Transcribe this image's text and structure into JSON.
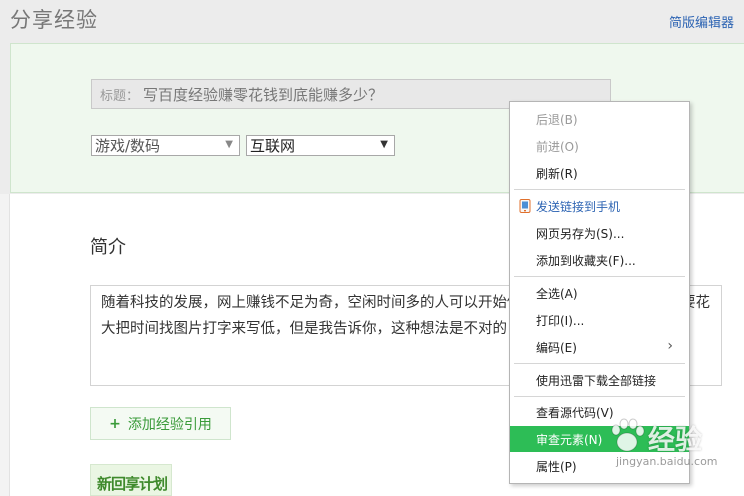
{
  "header": {
    "title": "分享经验",
    "simple_editor_link": "简版编辑器"
  },
  "form": {
    "title_prefix": "标题：",
    "title_value": "写百度经验赚零花钱到底能赚多少？",
    "category_select": "游戏/数码",
    "subcategory_select": "互联网",
    "select_arrow": "▼"
  },
  "intro": {
    "heading": "简介",
    "text": "随着科技的发展，网上赚钱不足为奇，空闲时间多的人可以开始做的人觉得一天一毛两毛却要花大把时间找图片打字来写低，但是我告诉你，这种想法是不对的，这种现象也是正常",
    "add_reference_plus": "+",
    "add_reference_label": "添加经验引用",
    "thumbnail_text": "新回享计划"
  },
  "context_menu": {
    "items": [
      {
        "label": "后退(B)"
      },
      {
        "label": "前进(O)"
      },
      {
        "label": "刷新(R)"
      },
      {
        "label": "发送链接到手机"
      },
      {
        "label": "网页另存为(S)..."
      },
      {
        "label": "添加到收藏夹(F)..."
      },
      {
        "label": "全选(A)"
      },
      {
        "label": "打印(I)..."
      },
      {
        "label": "编码(E)"
      },
      {
        "label": "使用迅雷下载全部链接"
      },
      {
        "label": "查看源代码(V)"
      },
      {
        "label": "审查元素(N)"
      },
      {
        "label": "属性(P)"
      }
    ],
    "submenu_arrow": "›",
    "highlight_color": "#2dbd56"
  },
  "watermark": {
    "brand": "经验",
    "url": "jingyan.baidu.com"
  }
}
